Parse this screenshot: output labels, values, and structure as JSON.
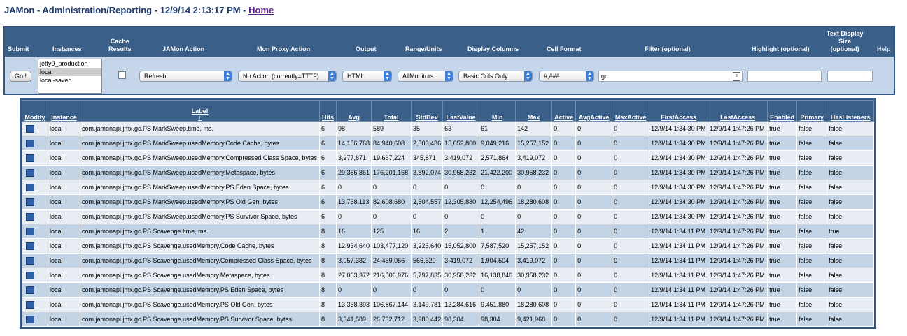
{
  "page": {
    "title": "JAMon - Administration/Reporting - 12/9/14 2:13:17 PM - ",
    "home_link": "Home"
  },
  "controls": {
    "headers": {
      "submit": "Submit",
      "instances": "Instances",
      "cache_line1": "Cache",
      "cache_line2": "Results",
      "jamon_action": "JAMon Action",
      "mon_proxy_action": "Mon Proxy Action",
      "output": "Output",
      "range_units": "Range/Units",
      "display_columns": "Display Columns",
      "cell_format": "Cell Format",
      "filter": "Filter (optional)",
      "highlight": "Highlight (optional)",
      "text_display_line1": "Text Display",
      "text_display_line2": "Size",
      "text_display_line3": "(optional)",
      "help": "Help"
    },
    "go_button": "Go !",
    "instances": [
      "jetty9_production",
      "local",
      "local-saved"
    ],
    "instances_selected": "local",
    "jamon_action": "Refresh",
    "mon_proxy_action": "No Action (currently=TTTF)",
    "output": "HTML",
    "range_units": "AllMonitors",
    "display_columns": "Basic Cols Only",
    "cell_format": "#,###",
    "filter_value": "gc",
    "highlight_value": "",
    "text_display_size": ""
  },
  "table": {
    "columns": [
      "Modify",
      "Instance",
      "Label",
      "Hits",
      "Avg",
      "Total",
      "StdDev",
      "LastValue",
      "Min",
      "Max",
      "Active",
      "AvgActive",
      "MaxActive",
      "FirstAccess",
      "LastAccess",
      "Enabled",
      "Primary",
      "HasListeners"
    ],
    "sort_indicator": "↑",
    "rows": [
      [
        "local",
        "com.jamonapi.jmx.gc.PS MarkSweep.time, ms.",
        "6",
        "98",
        "589",
        "35",
        "63",
        "61",
        "142",
        "0",
        "0",
        "0",
        "12/9/14 1:34:30 PM",
        "12/9/14 1:47:26 PM",
        "true",
        "false",
        "false"
      ],
      [
        "local",
        "com.jamonapi.jmx.gc.PS MarkSweep.usedMemory.Code Cache, bytes",
        "6",
        "14,156,768",
        "84,940,608",
        "2,503,486",
        "15,052,800",
        "9,049,216",
        "15,257,152",
        "0",
        "0",
        "0",
        "12/9/14 1:34:30 PM",
        "12/9/14 1:47:26 PM",
        "true",
        "false",
        "false"
      ],
      [
        "local",
        "com.jamonapi.jmx.gc.PS MarkSweep.usedMemory.Compressed Class Space, bytes",
        "6",
        "3,277,871",
        "19,667,224",
        "345,871",
        "3,419,072",
        "2,571,864",
        "3,419,072",
        "0",
        "0",
        "0",
        "12/9/14 1:34:30 PM",
        "12/9/14 1:47:26 PM",
        "true",
        "false",
        "false"
      ],
      [
        "local",
        "com.jamonapi.jmx.gc.PS MarkSweep.usedMemory.Metaspace, bytes",
        "6",
        "29,366,861",
        "176,201,168",
        "3,892,074",
        "30,958,232",
        "21,422,200",
        "30,958,232",
        "0",
        "0",
        "0",
        "12/9/14 1:34:30 PM",
        "12/9/14 1:47:26 PM",
        "true",
        "false",
        "false"
      ],
      [
        "local",
        "com.jamonapi.jmx.gc.PS MarkSweep.usedMemory.PS Eden Space, bytes",
        "6",
        "0",
        "0",
        "0",
        "0",
        "0",
        "0",
        "0",
        "0",
        "0",
        "12/9/14 1:34:30 PM",
        "12/9/14 1:47:26 PM",
        "true",
        "false",
        "false"
      ],
      [
        "local",
        "com.jamonapi.jmx.gc.PS MarkSweep.usedMemory.PS Old Gen, bytes",
        "6",
        "13,768,113",
        "82,608,680",
        "2,504,557",
        "12,305,880",
        "12,254,496",
        "18,280,608",
        "0",
        "0",
        "0",
        "12/9/14 1:34:30 PM",
        "12/9/14 1:47:26 PM",
        "true",
        "false",
        "false"
      ],
      [
        "local",
        "com.jamonapi.jmx.gc.PS MarkSweep.usedMemory.PS Survivor Space, bytes",
        "6",
        "0",
        "0",
        "0",
        "0",
        "0",
        "0",
        "0",
        "0",
        "0",
        "12/9/14 1:34:30 PM",
        "12/9/14 1:47:26 PM",
        "true",
        "false",
        "false"
      ],
      [
        "local",
        "com.jamonapi.jmx.gc.PS Scavenge.time, ms.",
        "8",
        "16",
        "125",
        "16",
        "2",
        "1",
        "42",
        "0",
        "0",
        "0",
        "12/9/14 1:34:11 PM",
        "12/9/14 1:47:26 PM",
        "true",
        "false",
        "true"
      ],
      [
        "local",
        "com.jamonapi.jmx.gc.PS Scavenge.usedMemory.Code Cache, bytes",
        "8",
        "12,934,640",
        "103,477,120",
        "3,225,640",
        "15,052,800",
        "7,587,520",
        "15,257,152",
        "0",
        "0",
        "0",
        "12/9/14 1:34:11 PM",
        "12/9/14 1:47:26 PM",
        "true",
        "false",
        "false"
      ],
      [
        "local",
        "com.jamonapi.jmx.gc.PS Scavenge.usedMemory.Compressed Class Space, bytes",
        "8",
        "3,057,382",
        "24,459,056",
        "566,620",
        "3,419,072",
        "1,904,504",
        "3,419,072",
        "0",
        "0",
        "0",
        "12/9/14 1:34:11 PM",
        "12/9/14 1:47:26 PM",
        "true",
        "false",
        "false"
      ],
      [
        "local",
        "com.jamonapi.jmx.gc.PS Scavenge.usedMemory.Metaspace, bytes",
        "8",
        "27,063,372",
        "216,506,976",
        "5,797,835",
        "30,958,232",
        "16,138,840",
        "30,958,232",
        "0",
        "0",
        "0",
        "12/9/14 1:34:11 PM",
        "12/9/14 1:47:26 PM",
        "true",
        "false",
        "false"
      ],
      [
        "local",
        "com.jamonapi.jmx.gc.PS Scavenge.usedMemory.PS Eden Space, bytes",
        "8",
        "0",
        "0",
        "0",
        "0",
        "0",
        "0",
        "0",
        "0",
        "0",
        "12/9/14 1:34:11 PM",
        "12/9/14 1:47:26 PM",
        "true",
        "false",
        "false"
      ],
      [
        "local",
        "com.jamonapi.jmx.gc.PS Scavenge.usedMemory.PS Old Gen, bytes",
        "8",
        "13,358,393",
        "106,867,144",
        "3,149,781",
        "12,284,616",
        "9,451,880",
        "18,280,608",
        "0",
        "0",
        "0",
        "12/9/14 1:34:11 PM",
        "12/9/14 1:47:26 PM",
        "true",
        "false",
        "false"
      ],
      [
        "local",
        "com.jamonapi.jmx.gc.PS Scavenge.usedMemory.PS Survivor Space, bytes",
        "8",
        "3,341,589",
        "26,732,712",
        "3,980,442",
        "98,304",
        "98,304",
        "9,421,968",
        "0",
        "0",
        "0",
        "12/9/14 1:34:11 PM",
        "12/9/14 1:47:26 PM",
        "true",
        "false",
        "false"
      ]
    ]
  }
}
